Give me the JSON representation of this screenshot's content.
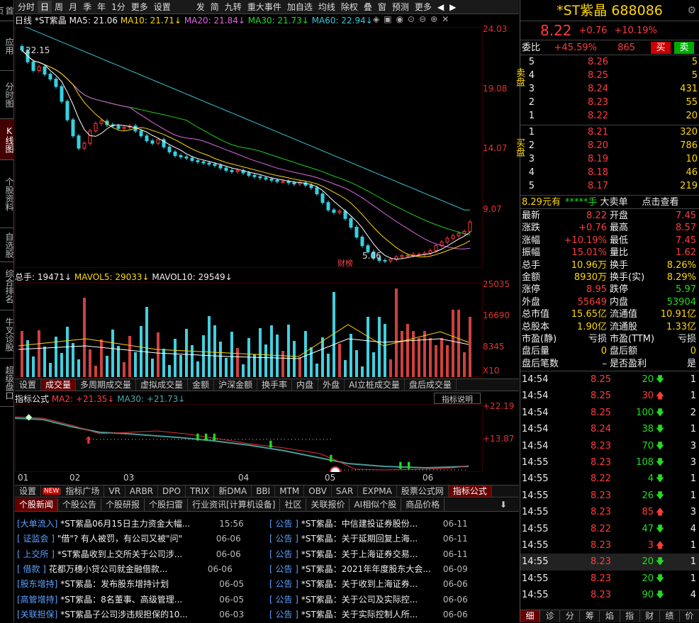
{
  "sidenav": [
    "首页",
    "应用",
    "分时图",
    "K线图",
    "个股资料",
    "自选股",
    "综合排名",
    "牛叉诊股",
    "超级盘口"
  ],
  "toolbar": [
    "分时",
    "日",
    "周",
    "月",
    "季",
    "年",
    "1分",
    "更多",
    "设置",
    "发",
    "简",
    "九转",
    "重大事件",
    "加自选",
    "均线",
    "除权",
    "叠",
    "窗",
    "预测",
    "更多"
  ],
  "chart": {
    "period": "日线",
    "name": "*ST紫晶",
    "ma5": "MA5: 21.06",
    "ma10": "MA10: 21.71↓",
    "ma20": "MA20: 21.84↓",
    "ma30": "MA30: 21.73↓",
    "ma60": "MA60: 22.94↓",
    "high_label": "22.15",
    "low_label": "5.06",
    "annot": "财榜",
    "y_ticks": [
      "24.03",
      "19.08",
      "14.07",
      "9.07"
    ],
    "vol_info": "总手: 19471↓",
    "mavol5": "MAVOL5: 29033↓",
    "mavol10": "MAVOL10: 29549↓",
    "vol_ticks": [
      "25035",
      "16690",
      "8345",
      "X10"
    ],
    "ind_title": "指标公式",
    "ind_ma2": "MA2: +21.35↓",
    "ind_ma30": "MA30: +21.73↓",
    "ind_help": "指标说明",
    "ind_ticks": [
      "+22.19",
      "+13.87"
    ],
    "x_months": [
      "01",
      "02",
      "03",
      "04",
      "05",
      "06"
    ]
  },
  "chart_data": {
    "type": "candlestick",
    "title": "*ST紫晶 日线",
    "ylim": [
      4.5,
      24.03
    ],
    "close_path_note": "",
    "closes": [
      22.15,
      21.2,
      20.5,
      20.8,
      20.2,
      19.8,
      19.2,
      18.0,
      16.5,
      15.2,
      14.2,
      14.6,
      15.6,
      16.2,
      16.4,
      16.1,
      16.0,
      15.8,
      15.9,
      16.0,
      15.6,
      15.2,
      14.8,
      14.6,
      14.9,
      14.3,
      13.9,
      13.6,
      13.5,
      13.4,
      13.2,
      13.1,
      13.0,
      12.9,
      12.8,
      12.6,
      12.4,
      12.3,
      12.4,
      12.2,
      12.0,
      11.9,
      11.8,
      11.7,
      11.6,
      11.5,
      11.5,
      11.4,
      11.3,
      11.4,
      11.2,
      11.0,
      10.5,
      9.8,
      9.2,
      9.0,
      9.1,
      8.5,
      7.8,
      7.0,
      6.3,
      5.8,
      5.3,
      5.1,
      5.06,
      5.2,
      5.4,
      5.5,
      5.5,
      5.6,
      5.6,
      5.7,
      5.9,
      6.3,
      6.6,
      6.9,
      7.1,
      7.3,
      7.46,
      8.22
    ]
  },
  "tabs_mid": [
    "设置",
    "成交量",
    "多周期成交量",
    "虚拟成交量",
    "金额",
    "沪深金额",
    "换手率",
    "内盘",
    "外盘",
    "AI立桩成交量",
    "盘后成交量"
  ],
  "tabs_bottom": [
    "设置",
    "指标广场",
    "VR",
    "ARBR",
    "DPO",
    "TRIX",
    "新DMA",
    "BBI",
    "MTM",
    "OBV",
    "SAR",
    "EXPMA",
    "股票公式网",
    "指标公式"
  ],
  "new_badge": "NEW",
  "news_tabs": [
    "个股新闻",
    "个股公告",
    "个股研报",
    "个股扫雷",
    "行业资讯[计算机设备]",
    "社区",
    "关联报价",
    "AI相似个股",
    "商品价格"
  ],
  "news_left": [
    {
      "tag": "[大单流入]",
      "text": "*ST紫晶06月15日主力资金大幅...",
      "date": "15:56"
    },
    {
      "tag": "[ 证监会 ]",
      "text": "\"借\"? 有人被罚，有公司又被\"问\"",
      "date": "06-06"
    },
    {
      "tag": "[ 上交所 ]",
      "text": "*ST紫晶收到上交所关于公司涉...",
      "date": "06-06"
    },
    {
      "tag": "[  借款  ]",
      "text": "花都万穗小贷公司就金融借款...",
      "date": "06-06"
    },
    {
      "tag": "[股东增持]",
      "text": "*ST紫晶：发布股东增持计划",
      "date": "06-05"
    },
    {
      "tag": "[高管增持]",
      "text": "*ST紫晶：8名董事、高级管理...",
      "date": "06-05"
    },
    {
      "tag": "[关联担保]",
      "text": "*ST紫晶子公司涉违规担保的10...",
      "date": "06-03"
    }
  ],
  "news_right": [
    {
      "tag": "[  公告  ]",
      "text": "*ST紫晶：中信建投证券股份...",
      "date": "06-11"
    },
    {
      "tag": "[  公告  ]",
      "text": "*ST紫晶：关于延期回复上海...",
      "date": "06-11"
    },
    {
      "tag": "[  公告  ]",
      "text": "*ST紫晶：关于上海证券交易...",
      "date": "06-11"
    },
    {
      "tag": "[  公告  ]",
      "text": "*ST紫晶：2021年年度股东大会...",
      "date": "06-09"
    },
    {
      "tag": "[  公告  ]",
      "text": "*ST紫晶：关于收到上海证券...",
      "date": "06-06"
    },
    {
      "tag": "[  公告  ]",
      "text": "*ST紫晶：关于公司及实际控...",
      "date": "06-06"
    },
    {
      "tag": "[  公告  ]",
      "text": "*ST紫晶：关于实际控制人所...",
      "date": "06-06"
    }
  ],
  "quote": {
    "name": "*ST紫晶",
    "code": "688086",
    "price": "8.22",
    "change": "+0.76",
    "pct": "+10.19%",
    "weibi_label": "委比",
    "weibi": "+45.59%",
    "weicha": "865",
    "buy_btn": "买",
    "sell_btn": "卖",
    "sell_label": "卖盘",
    "buy_label": "买盘",
    "asks": [
      [
        "5",
        "8.26",
        "5"
      ],
      [
        "4",
        "8.25",
        "5"
      ],
      [
        "3",
        "8.24",
        "431"
      ],
      [
        "2",
        "8.23",
        "55"
      ],
      [
        "1",
        "8.22",
        "20"
      ]
    ],
    "bids": [
      [
        "1",
        "8.21",
        "320"
      ],
      [
        "2",
        "8.20",
        "786"
      ],
      [
        "3",
        "8.19",
        "10"
      ],
      [
        "4",
        "8.18",
        "46"
      ],
      [
        "5",
        "8.17",
        "219"
      ]
    ],
    "big_price": "8.29元有",
    "big_stars": "*****手",
    "big_text": "大卖单",
    "big_link": "点击查看",
    "stats": [
      [
        "最新",
        "8.22",
        "开盘",
        "7.45"
      ],
      [
        "涨跌",
        "+0.76",
        "最高",
        "8.57"
      ],
      [
        "涨幅",
        "+10.19%",
        "最低",
        "7.45"
      ],
      [
        "振幅",
        "15.01%",
        "量比",
        "1.62"
      ],
      [
        "总手",
        "10.96万",
        "换手",
        "8.26%"
      ],
      [
        "金额",
        "8930万",
        "换手(实)",
        "8.29%"
      ],
      [
        "涨停",
        "8.95",
        "跌停",
        "5.97"
      ],
      [
        "外盘",
        "55649",
        "内盘",
        "53904"
      ],
      [
        "总市值",
        "15.65亿",
        "流通值",
        "10.91亿"
      ],
      [
        "总股本",
        "1.90亿",
        "流通股",
        "1.33亿"
      ],
      [
        "市盈(静)",
        "亏损",
        "市盈(TTM)",
        "亏损"
      ],
      [
        "盘后量",
        "0",
        "盘后额",
        "0"
      ],
      [
        "盘后笔数",
        "–",
        "是否盈利",
        "是"
      ]
    ],
    "ticks": [
      [
        "14:54",
        "8.25",
        "20",
        "down",
        "1"
      ],
      [
        "14:54",
        "8.25",
        "30",
        "up",
        "1"
      ],
      [
        "14:54",
        "8.25",
        "100",
        "down",
        "2"
      ],
      [
        "14:54",
        "8.24",
        "38",
        "down",
        "1"
      ],
      [
        "14:54",
        "8.23",
        "70",
        "down",
        "3"
      ],
      [
        "14:55",
        "8.23",
        "108",
        "down",
        "3"
      ],
      [
        "14:55",
        "8.22",
        "4",
        "down",
        "1"
      ],
      [
        "14:55",
        "8.23",
        "26",
        "down",
        "1"
      ],
      [
        "14:55",
        "8.23",
        "85",
        "up",
        "3"
      ],
      [
        "14:55",
        "8.22",
        "47",
        "down",
        "4"
      ],
      [
        "14:55",
        "8.23",
        "3",
        "up",
        "1"
      ],
      [
        "14:55",
        "8.23",
        "20",
        "down",
        "1"
      ],
      [
        "14:55",
        "8.23",
        "20",
        "down",
        "1"
      ],
      [
        "14:55",
        "8.23",
        "90",
        "down",
        "4"
      ]
    ],
    "bottom_tabs": [
      "细",
      "诊",
      "分",
      "筹",
      "焰",
      "指",
      "财",
      "绩",
      "价"
    ]
  }
}
